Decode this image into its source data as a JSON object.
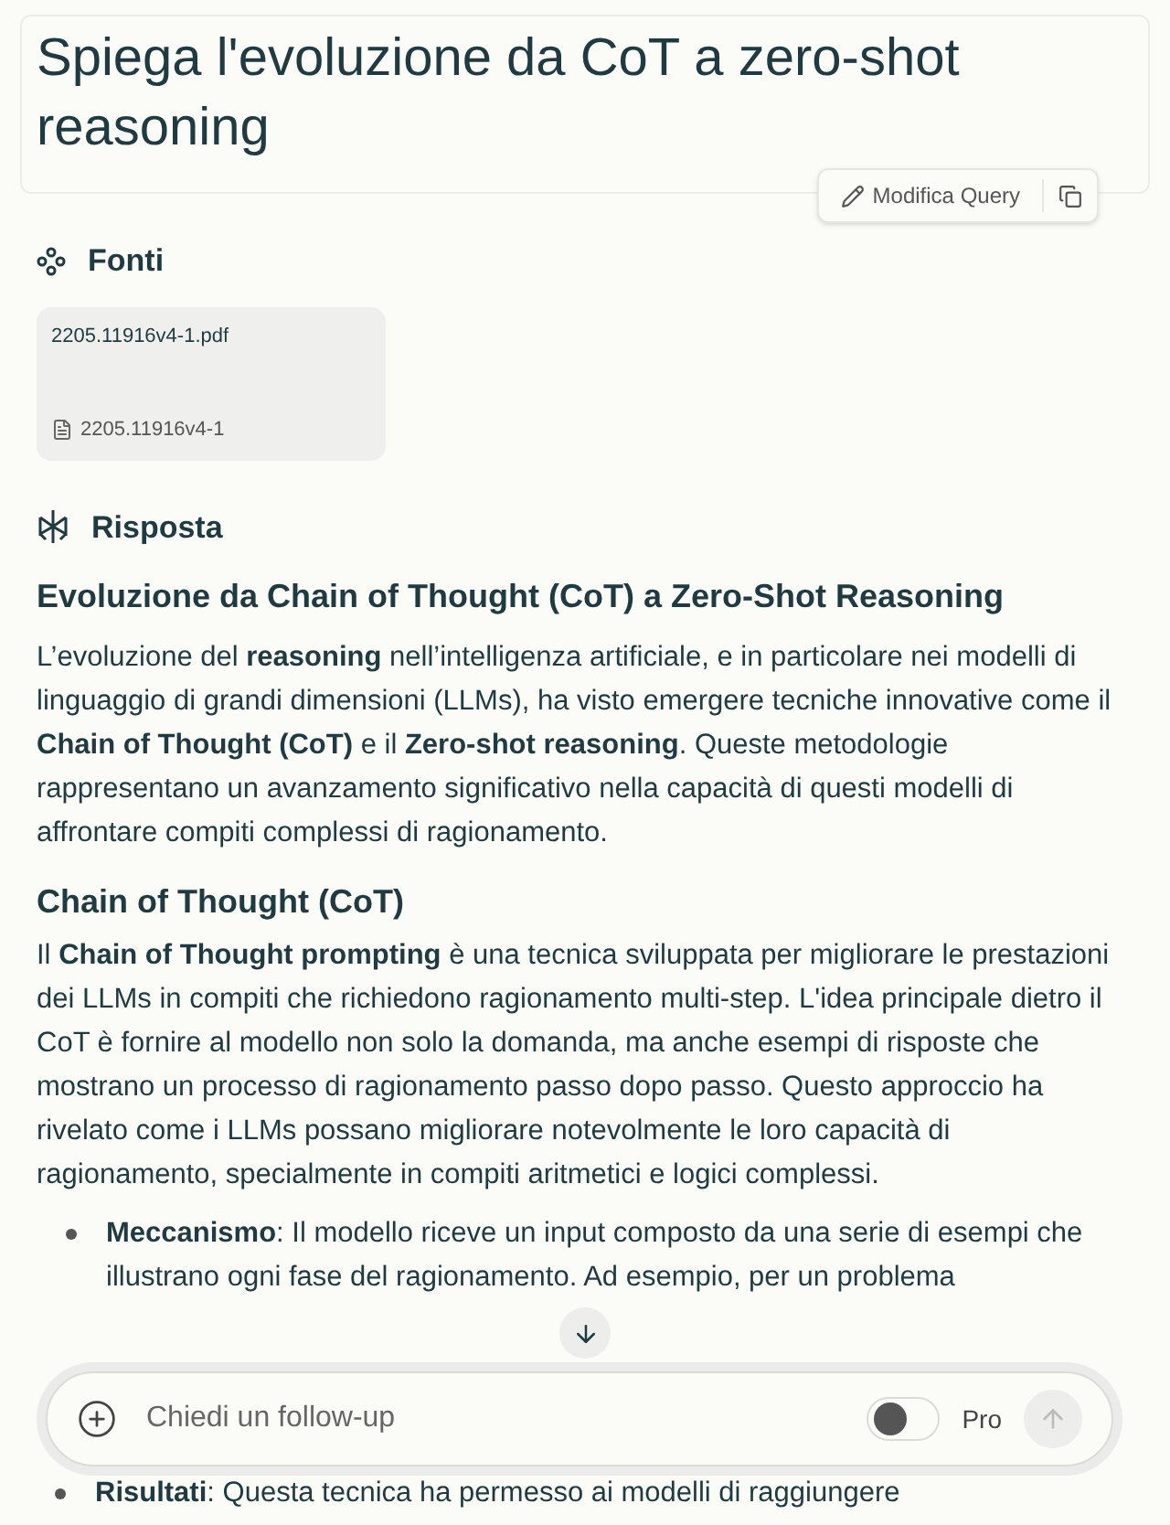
{
  "query": {
    "title": "Spiega l'evoluzione da CoT a zero-shot reasoning",
    "edit_label": "Modifica Query"
  },
  "sources": {
    "heading": "Fonti",
    "items": [
      {
        "title": "2205.11916v4-1.pdf",
        "name": "2205.11916v4-1"
      }
    ]
  },
  "answer": {
    "heading": "Risposta",
    "blocks": [
      {
        "kind": "h2",
        "text": "Evoluzione da Chain of Thought (CoT) a Zero-Shot Reasoning"
      },
      {
        "kind": "p",
        "text": "L’evoluzione del **reasoning** nell’intelligenza artificiale, e in particolare nei modelli di linguaggio di grandi dimensioni (LLMs), ha visto emergere tecniche innovative come il **Chain of Thought (CoT)** e il **Zero-shot reasoning**. Queste metodologie rappresentano un avanzamento significativo nella capacità di questi modelli di affrontare compiti complessi di ragionamento."
      },
      {
        "kind": "h3",
        "text": "Chain of Thought (CoT)"
      },
      {
        "kind": "p",
        "text": "Il **Chain of Thought prompting** è una tecnica sviluppata per migliorare le prestazioni dei LLMs in compiti che richiedono ragionamento multi-step. L'idea principale dietro il CoT è fornire al modello non solo la domanda, ma anche esempi di risposte che mostrano un processo di ragionamento passo dopo passo. Questo approccio ha rivelato come i LLMs possano migliorare notevolmente le loro capacità di ragionamento, specialmente in compiti aritmetici e logici complessi."
      },
      {
        "kind": "li",
        "text": "**Meccanismo**: Il modello riceve un input composto da una serie di esempi che illustrano ogni fase del ragionamento. Ad esempio, per un problema"
      }
    ]
  },
  "composer": {
    "placeholder": "Chiedi un follow-up",
    "pro": {
      "label": "Pro",
      "on": false
    }
  },
  "footer_line": "**Risultati**: Questa tecnica ha permesso ai modelli di raggiungere"
}
